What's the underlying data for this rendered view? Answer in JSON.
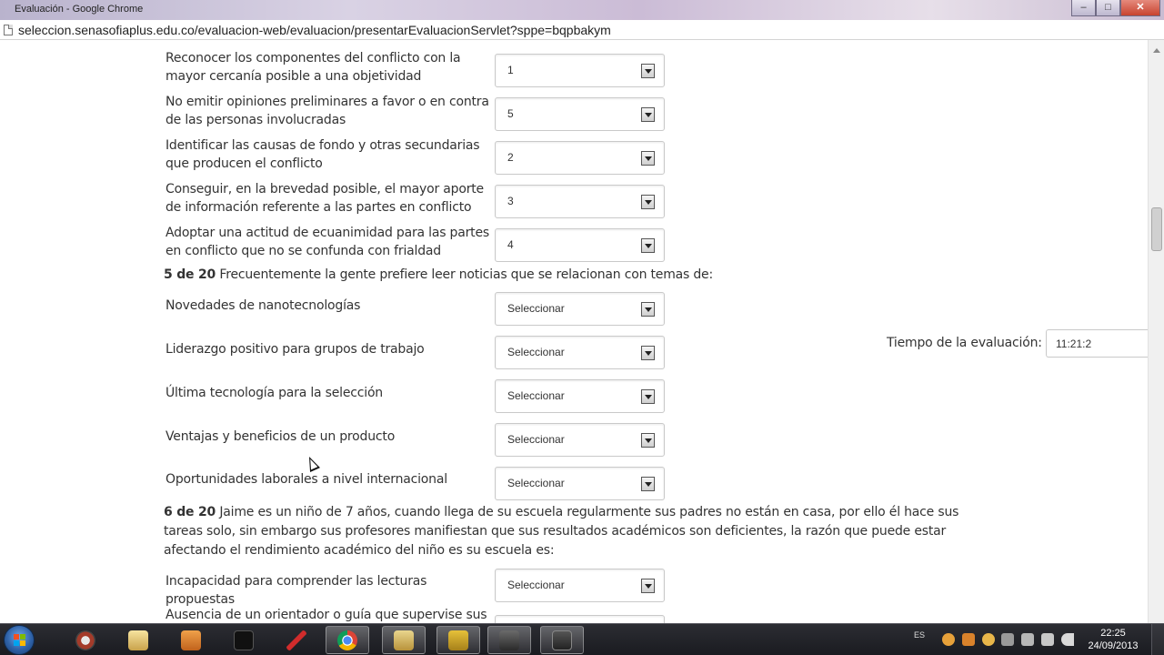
{
  "window": {
    "title": "Evaluación - Google Chrome",
    "minimize": "–",
    "maximize": "□",
    "close": "✕"
  },
  "address": {
    "url": "seleccion.senasofiaplus.edu.co/evaluacion-web/evaluacion/presentarEvaluacionServlet?sppe=bqpbakym"
  },
  "rows_q4": [
    {
      "label": "Reconocer los componentes del conflicto con la mayor cercanía posible a una objetividad",
      "value": "1"
    },
    {
      "label": "No emitir opiniones preliminares a favor o en contra de las personas involucradas",
      "value": "5"
    },
    {
      "label": "Identificar las causas de fondo y otras secundarias que producen el conflicto",
      "value": "2"
    },
    {
      "label": "Conseguir, en la brevedad posible, el mayor aporte de información referente a las partes en conflicto",
      "value": "3"
    },
    {
      "label": "Adoptar una actitud de ecuanimidad para las partes en conflicto que no se confunda con frialdad",
      "value": "4"
    }
  ],
  "question5": {
    "number": "5 de 20",
    "text": "Frecuentemente la gente prefiere leer noticias que se relacionan con temas de:"
  },
  "rows_q5": [
    {
      "label": "Novedades de nanotecnologías",
      "value": "Seleccionar"
    },
    {
      "label": "Liderazgo positivo para grupos de trabajo",
      "value": "Seleccionar"
    },
    {
      "label": "Última tecnología para la selección",
      "value": "Seleccionar"
    },
    {
      "label": "Ventajas y beneficios de un producto",
      "value": "Seleccionar"
    },
    {
      "label": "Oportunidades laborales a nivel internacional",
      "value": "Seleccionar"
    }
  ],
  "question6": {
    "number": "6 de 20",
    "text": "Jaime es un niño de 7 años, cuando llega de su escuela regularmente sus padres no están en casa, por ello él hace sus tareas solo, sin embargo sus profesores manifiestan que sus resultados académicos son deficientes, la razón que puede estar afectando el rendimiento académico del niño es su escuela es:"
  },
  "rows_q6": [
    {
      "label": "Incapacidad para comprender las lecturas propuestas",
      "value": "Seleccionar"
    },
    {
      "label": "Ausencia de un orientador o guía que supervise sus",
      "value": ""
    }
  ],
  "timer": {
    "label": "Tiempo de la evaluación:",
    "value": "11:21:2"
  },
  "taskbar": {
    "time": "22:25",
    "date": "24/09/2013",
    "lang": "ES",
    "apps": [
      "ie-icon",
      "explorer-icon",
      "media-player-icon",
      "blackberry-icon",
      "pen-icon",
      "chrome-icon",
      "folder-icon",
      "hd-video-icon",
      "app-icon",
      "game-icon"
    ]
  },
  "colors": {
    "text": "#333333",
    "select_border": "#c9c9c9",
    "taskbar": "#1a1b20"
  }
}
